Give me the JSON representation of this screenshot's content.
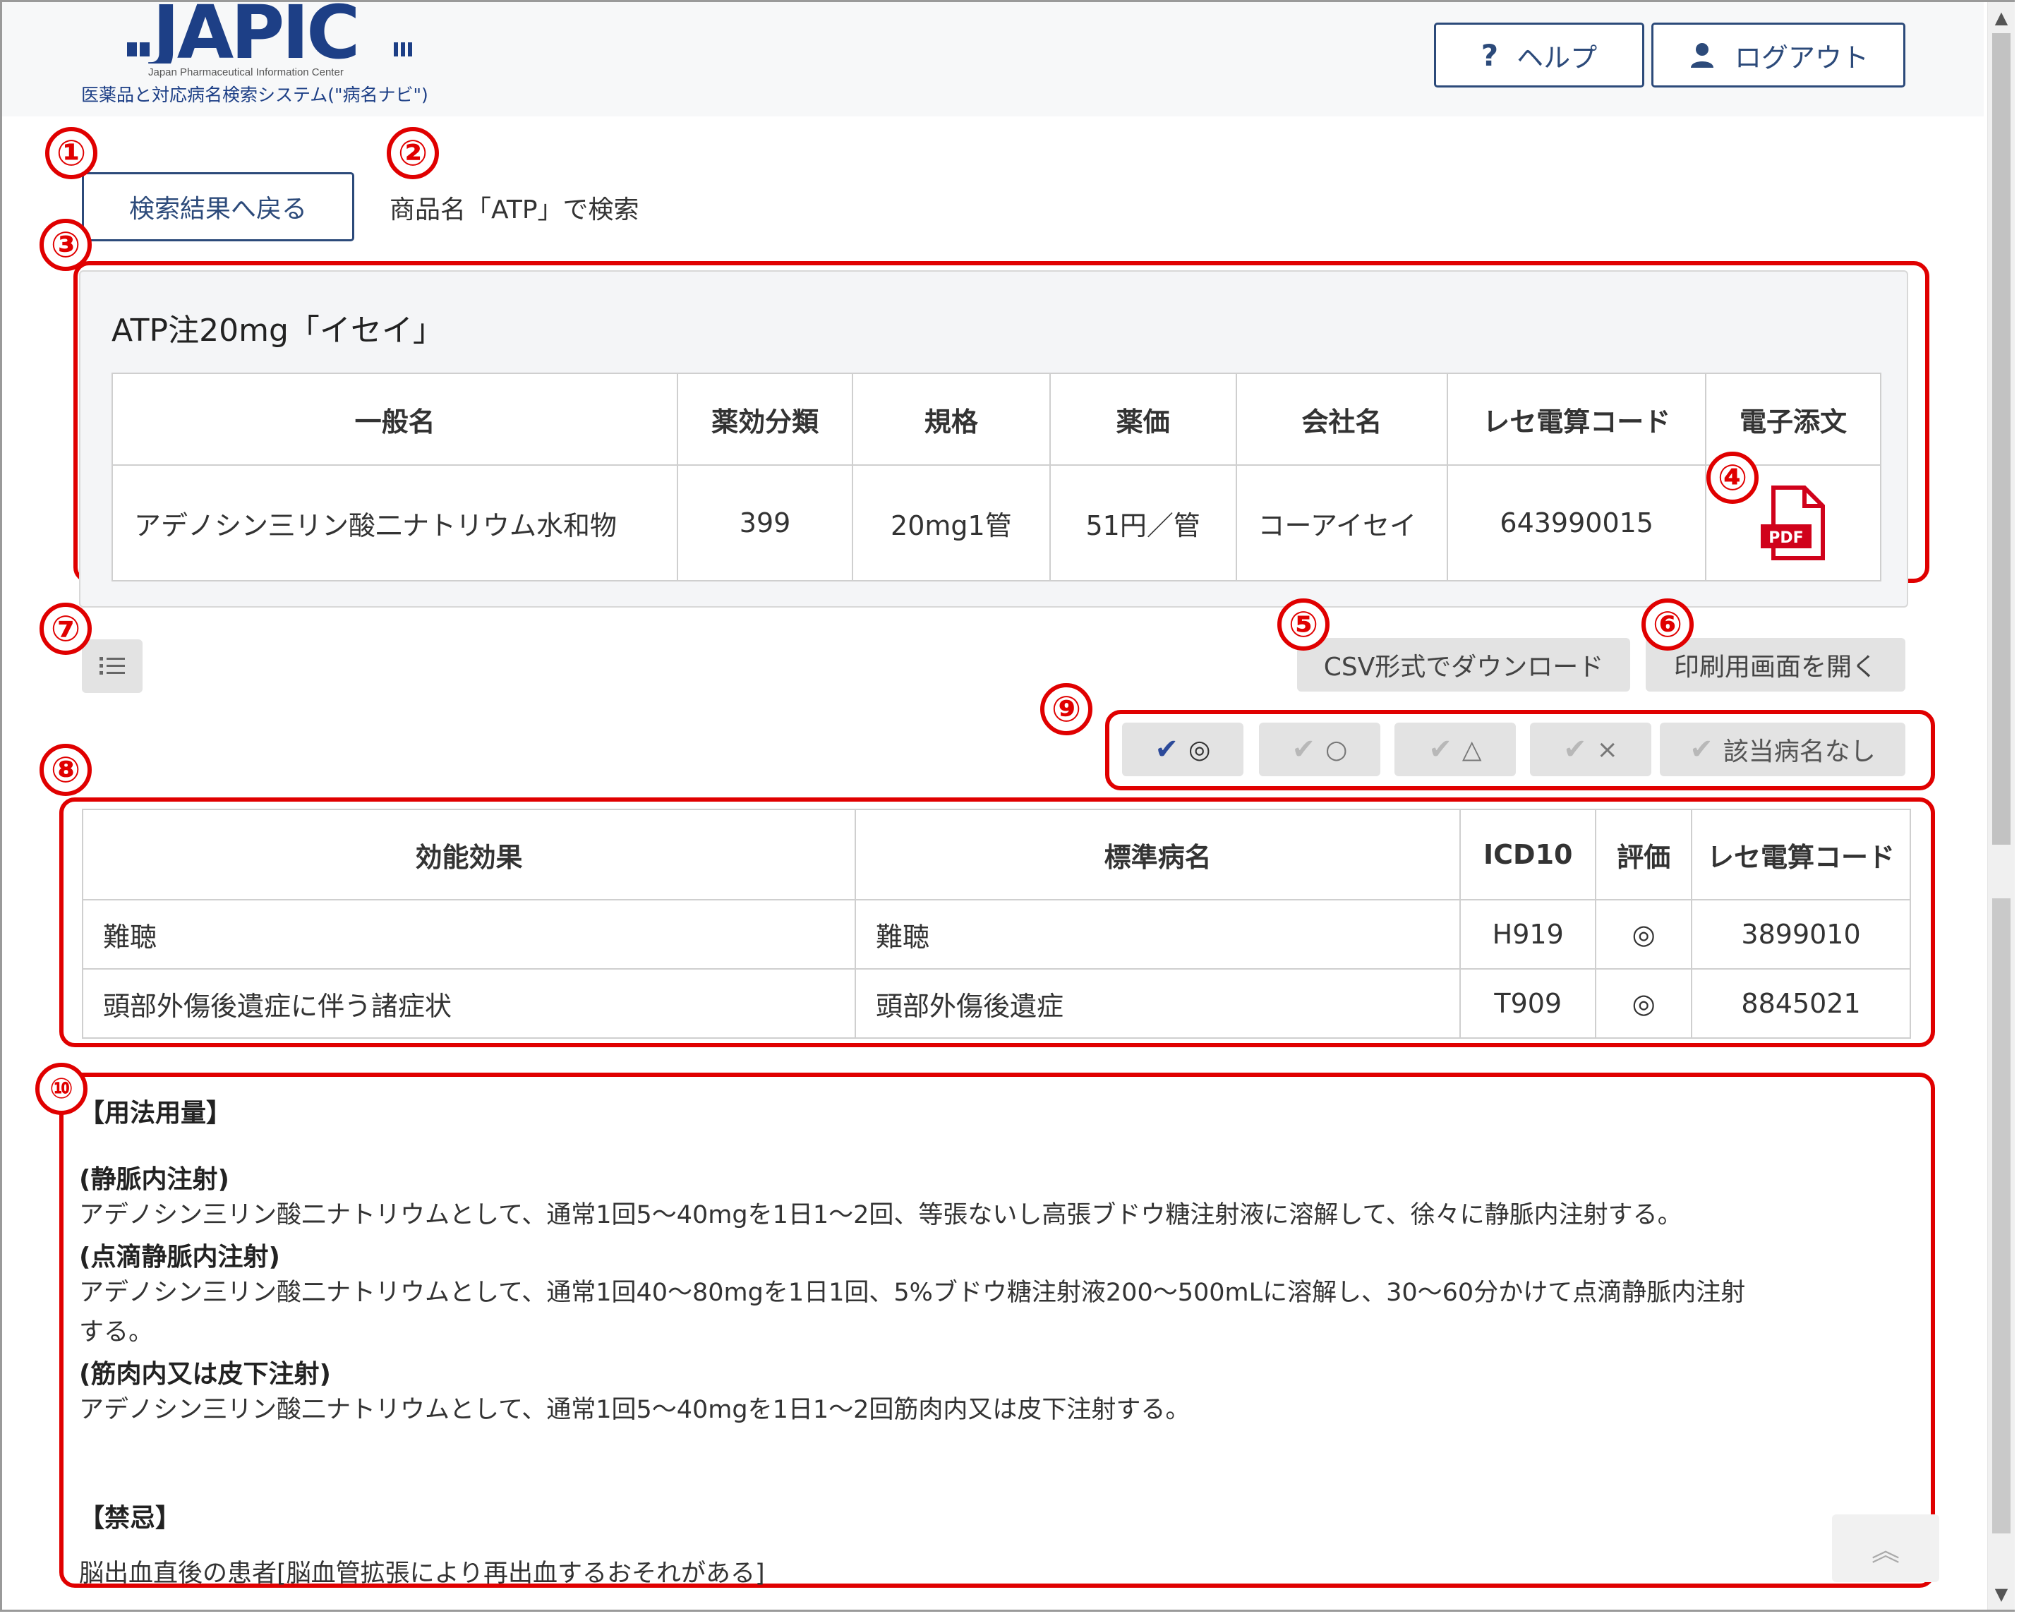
{
  "header": {
    "logo_text": "JAPIC",
    "logo_subtitle": "Japan Pharmaceutical Information Center",
    "system_name": "医薬品と対応病名検索システム(\"病名ナビ\")",
    "help_label": "ヘルプ",
    "logout_label": "ログアウト"
  },
  "callouts": [
    "①",
    "②",
    "③",
    "④",
    "⑤",
    "⑥",
    "⑦",
    "⑧",
    "⑨",
    "⑩"
  ],
  "nav": {
    "back_label": "検索結果へ戻る",
    "search_query": "商品名「ATP」で検索"
  },
  "product": {
    "title": "ATP注20mg「イセイ」",
    "headers": [
      "一般名",
      "薬効分類",
      "規格",
      "薬価",
      "会社名",
      "レセ電算コード",
      "電子添文"
    ],
    "row": {
      "generic_name": "アデノシン三リン酸二ナトリウム水和物",
      "category": "399",
      "spec": "20mg1管",
      "price": "51円／管",
      "company": "コーアイセイ",
      "code": "643990015",
      "pdf_label": "PDF"
    }
  },
  "toolbar": {
    "csv_label": "CSV形式でダウンロード",
    "print_label": "印刷用画面を開く"
  },
  "filters": [
    {
      "label": "◎",
      "active": true
    },
    {
      "label": "○",
      "active": false
    },
    {
      "label": "△",
      "active": false
    },
    {
      "label": "×",
      "active": false
    },
    {
      "label": "該当病名なし",
      "active": false
    }
  ],
  "diseases": {
    "headers": [
      "効能効果",
      "標準病名",
      "ICD10",
      "評価",
      "レセ電算コード"
    ],
    "rows": [
      {
        "effect": "難聴",
        "name": "難聴",
        "icd10": "H919",
        "rating": "◎",
        "code": "3899010"
      },
      {
        "effect": "頭部外傷後遺症に伴う諸症状",
        "name": "頭部外傷後遺症",
        "icd10": "T909",
        "rating": "◎",
        "code": "8845021"
      }
    ]
  },
  "usage": {
    "heading": "【用法用量】",
    "sections": [
      {
        "title": "(静脈内注射)",
        "lines": [
          "アデノシン三リン酸二ナトリウムとして、通常1回5～40mgを1日1～2回、等張ないし高張ブドウ糖注射液に溶解して、徐々に静脈内注射する。"
        ]
      },
      {
        "title": "(点滴静脈内注射)",
        "lines": [
          "アデノシン三リン酸二ナトリウムとして、通常1回40～80mgを1日1回、5%ブドウ糖注射液200～500mLに溶解し、30～60分かけて点滴静脈内注射",
          "する。"
        ]
      },
      {
        "title": "(筋肉内又は皮下注射)",
        "lines": [
          "アデノシン三リン酸二ナトリウムとして、通常1回5～40mgを1日1～2回筋肉内又は皮下注射する。"
        ]
      }
    ],
    "contra_heading": "【禁忌】",
    "contra_text": "脳出血直後の患者[脳血管拡張により再出血するおそれがある]"
  },
  "colors": {
    "accent": "#2c4a7a",
    "callout": "#e00000",
    "pdf": "#d0021b"
  }
}
